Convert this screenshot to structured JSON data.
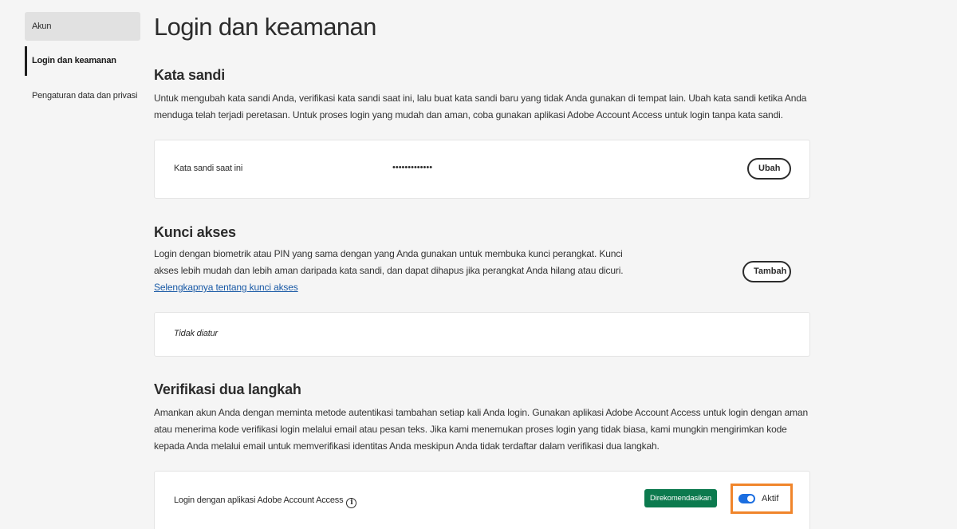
{
  "sidebar": {
    "items": [
      {
        "label": "Akun"
      },
      {
        "label": "Login dan keamanan"
      },
      {
        "label": "Pengaturan data dan privasi"
      }
    ]
  },
  "page": {
    "title": "Login dan keamanan"
  },
  "password": {
    "title": "Kata sandi",
    "description": "Untuk mengubah kata sandi Anda, verifikasi kata sandi saat ini, lalu buat kata sandi baru yang tidak Anda gunakan di tempat lain. Ubah kata sandi ketika Anda menduga telah terjadi peretasan. Untuk proses login yang mudah dan aman, coba gunakan aplikasi Adobe Account Access untuk login tanpa kata sandi.",
    "field_label": "Kata sandi saat ini",
    "masked_value": "•••••••••••••",
    "change_button": "Ubah"
  },
  "passkey": {
    "title": "Kunci akses",
    "description": "Login dengan biometrik atau PIN yang sama dengan yang Anda gunakan untuk membuka kunci perangkat. Kunci akses lebih mudah dan lebih aman daripada kata sandi, dan dapat dihapus jika perangkat Anda hilang atau dicuri.",
    "learn_more_link": "Selengkapnya tentang kunci akses",
    "add_button": "Tambah",
    "status": "Tidak diatur"
  },
  "two_step": {
    "title": "Verifikasi dua langkah",
    "description": "Amankan akun Anda dengan meminta metode autentikasi tambahan setiap kali Anda login. Gunakan aplikasi Adobe Account Access untuk login dengan aman atau menerima kode verifikasi login melalui email atau pesan teks. Jika kami menemukan proses login yang tidak biasa, kami mungkin mengirimkan kode kepada Anda melalui email untuk memverifikasi identitas Anda meskipun Anda tidak terdaftar dalam verifikasi dua langkah.",
    "option_label": "Login dengan aplikasi Adobe Account Access",
    "badge": "Direkomendasikan",
    "toggle_label": "Aktif",
    "toggle_on": true
  },
  "colors": {
    "accent": "#1b6ee0",
    "badge": "#0c7a4e",
    "highlight": "#f0852b",
    "link": "#1a5aa6"
  }
}
